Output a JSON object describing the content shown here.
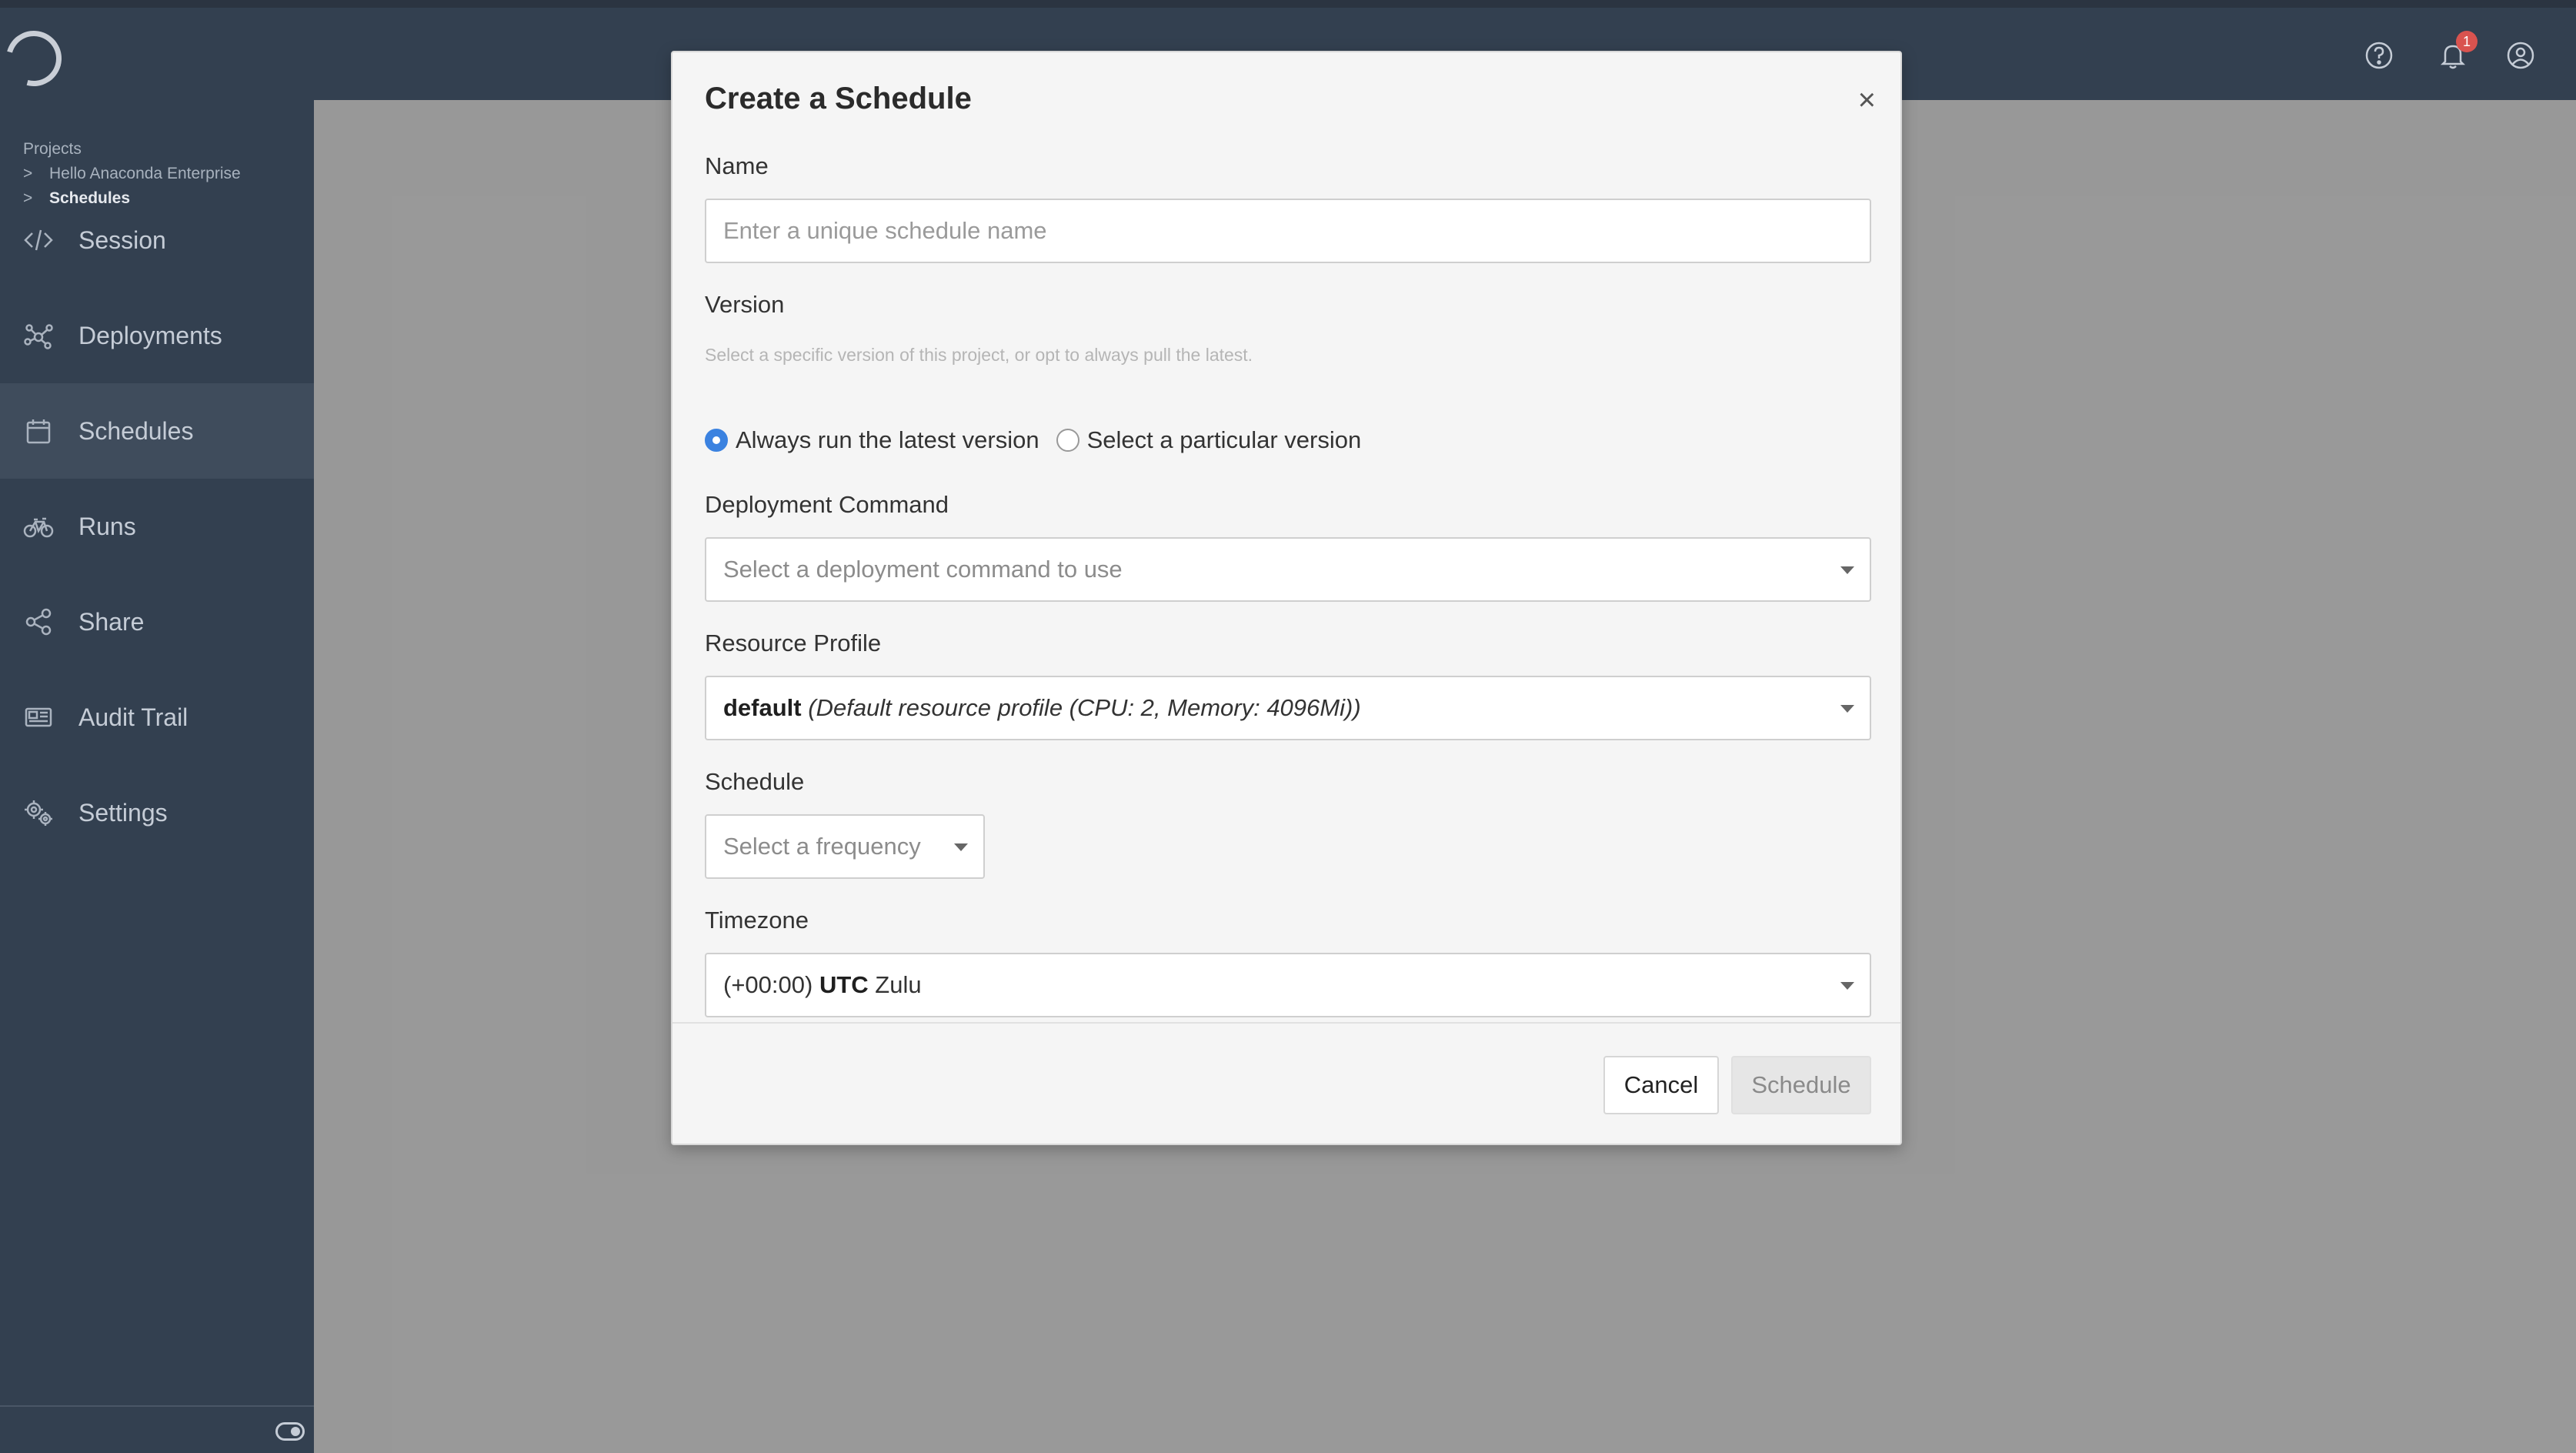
{
  "breadcrumb": {
    "root": "Projects",
    "project": "Hello Anaconda Enterprise",
    "current": "Schedules",
    "separator": ">"
  },
  "sidebar": {
    "items": [
      {
        "label": "Session",
        "icon": "code-icon",
        "active": false
      },
      {
        "label": "Deployments",
        "icon": "network-icon",
        "active": false
      },
      {
        "label": "Schedules",
        "icon": "calendar-icon",
        "active": true
      },
      {
        "label": "Runs",
        "icon": "bicycle-icon",
        "active": false
      },
      {
        "label": "Share",
        "icon": "share-icon",
        "active": false
      },
      {
        "label": "Audit Trail",
        "icon": "newspaper-icon",
        "active": false
      },
      {
        "label": "Settings",
        "icon": "gears-icon",
        "active": false
      }
    ]
  },
  "topbar": {
    "notification_count": "1",
    "icons": [
      "help-icon",
      "bell-icon",
      "user-icon"
    ]
  },
  "modal": {
    "title": "Create a Schedule",
    "close": "×",
    "name": {
      "label": "Name",
      "placeholder": "Enter a unique schedule name"
    },
    "version": {
      "label": "Version",
      "help": "Select a specific version of this project, or opt to always pull the latest.",
      "option_latest": "Always run the latest version",
      "option_particular": "Select a particular version",
      "selected": "latest"
    },
    "deployment_command": {
      "label": "Deployment Command",
      "placeholder": "Select a deployment command to use"
    },
    "resource_profile": {
      "label": "Resource Profile",
      "value_name": "default",
      "value_detail": "(Default resource profile (CPU: 2, Memory: 4096Mi))"
    },
    "schedule": {
      "label": "Schedule",
      "placeholder": "Select a frequency"
    },
    "timezone": {
      "label": "Timezone",
      "offset": "(+00:00)",
      "abbr": "UTC",
      "name": "Zulu"
    },
    "buttons": {
      "cancel": "Cancel",
      "submit": "Schedule"
    }
  },
  "colors": {
    "sidebar_bg": "#334050",
    "accent": "#3b82e0",
    "badge": "#d9534f"
  }
}
